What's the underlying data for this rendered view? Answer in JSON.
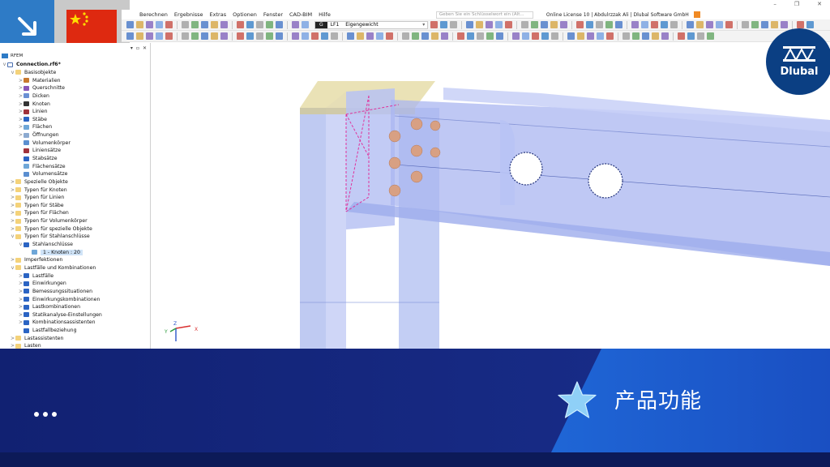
{
  "menu": {
    "items": [
      "Berechnen",
      "Ergebnisse",
      "Extras",
      "Optionen",
      "Fenster",
      "CAD-BIM",
      "Hilfe"
    ],
    "search_placeholder": "Geben Sie ein Schlüsselwort ein (Alt...",
    "license_text": "Online License 10 | Abdulrzzak Ali | Dlubal Software GmbH"
  },
  "toolbar": {
    "loadcase_group": "G",
    "loadcase_id": "LF1",
    "loadcase_name": "Eigengewicht"
  },
  "navigator": {
    "root_label": "RFEM",
    "file_label": "Connection.rf6*",
    "items": [
      {
        "label": "Basisobjekte",
        "level": 1,
        "chev": "v",
        "icon": "folder-icon",
        "color": "#f4d27a"
      },
      {
        "label": "Materialien",
        "level": 2,
        "chev": ">",
        "icon": "material-icon",
        "color": "#c9792e"
      },
      {
        "label": "Querschnitte",
        "level": 2,
        "chev": ">",
        "icon": "section-icon",
        "color": "#8a56b8"
      },
      {
        "label": "Dicken",
        "level": 2,
        "chev": ">",
        "icon": "thickness-icon",
        "color": "#6a8fd3"
      },
      {
        "label": "Knoten",
        "level": 2,
        "chev": ">",
        "icon": "node-icon",
        "color": "#333333"
      },
      {
        "label": "Linien",
        "level": 2,
        "chev": ">",
        "icon": "line-icon",
        "color": "#a0323c"
      },
      {
        "label": "Stäbe",
        "level": 2,
        "chev": ">",
        "icon": "member-icon",
        "color": "#2b64c3"
      },
      {
        "label": "Flächen",
        "level": 2,
        "chev": ">",
        "icon": "surface-icon",
        "color": "#6fa7d8"
      },
      {
        "label": "Öffnungen",
        "level": 2,
        "chev": ">",
        "icon": "opening-icon",
        "color": "#8caad0"
      },
      {
        "label": "Volumenkörper",
        "level": 2,
        "chev": "",
        "icon": "solid-icon",
        "color": "#5b8fd0"
      },
      {
        "label": "Liniensätze",
        "level": 2,
        "chev": "",
        "icon": "lineset-icon",
        "color": "#a0323c"
      },
      {
        "label": "Stabsätze",
        "level": 2,
        "chev": "",
        "icon": "memberset-icon",
        "color": "#2b64c3"
      },
      {
        "label": "Flächensätze",
        "level": 2,
        "chev": "",
        "icon": "surfaceset-icon",
        "color": "#6fa7d8"
      },
      {
        "label": "Volumensätze",
        "level": 2,
        "chev": "",
        "icon": "solidset-icon",
        "color": "#5b8fd0"
      },
      {
        "label": "Spezielle Objekte",
        "level": 1,
        "chev": ">",
        "icon": "folder-icon",
        "color": "#f4d27a"
      },
      {
        "label": "Typen für Knoten",
        "level": 1,
        "chev": ">",
        "icon": "folder-icon",
        "color": "#f4d27a"
      },
      {
        "label": "Typen für Linien",
        "level": 1,
        "chev": ">",
        "icon": "folder-icon",
        "color": "#f4d27a"
      },
      {
        "label": "Typen für Stäbe",
        "level": 1,
        "chev": ">",
        "icon": "folder-icon",
        "color": "#f4d27a"
      },
      {
        "label": "Typen für Flächen",
        "level": 1,
        "chev": ">",
        "icon": "folder-icon",
        "color": "#f4d27a"
      },
      {
        "label": "Typen für Volumenkörper",
        "level": 1,
        "chev": ">",
        "icon": "folder-icon",
        "color": "#f4d27a"
      },
      {
        "label": "Typen für spezielle Objekte",
        "level": 1,
        "chev": ">",
        "icon": "folder-icon",
        "color": "#f4d27a"
      },
      {
        "label": "Typen für Stahlanschlüsse",
        "level": 1,
        "chev": "v",
        "icon": "folder-icon",
        "color": "#f4d27a"
      },
      {
        "label": "Stahlanschlüsse",
        "level": 2,
        "chev": "v",
        "icon": "steel-joint-icon",
        "color": "#2b64c3"
      },
      {
        "label": "1 - Knoten : 20",
        "level": 3,
        "chev": "",
        "icon": "joint-item-icon",
        "color": "#6fa7d8",
        "selected": true
      },
      {
        "label": "Imperfektionen",
        "level": 1,
        "chev": ">",
        "icon": "folder-icon",
        "color": "#f4d27a"
      },
      {
        "label": "Lastfälle und Kombinationen",
        "level": 1,
        "chev": "v",
        "icon": "folder-icon",
        "color": "#f4d27a"
      },
      {
        "label": "Lastfälle",
        "level": 2,
        "chev": ">",
        "icon": "loadcase-icon",
        "color": "#2b64c3"
      },
      {
        "label": "Einwirkungen",
        "level": 2,
        "chev": ">",
        "icon": "action-icon",
        "color": "#2b64c3"
      },
      {
        "label": "Bemessungssituationen",
        "level": 2,
        "chev": ">",
        "icon": "design-situation-icon",
        "color": "#2b64c3"
      },
      {
        "label": "Einwirkungskombinationen",
        "level": 2,
        "chev": ">",
        "icon": "action-combination-icon",
        "color": "#2b64c3"
      },
      {
        "label": "Lastkombinationen",
        "level": 2,
        "chev": ">",
        "icon": "load-combination-icon",
        "color": "#2b64c3"
      },
      {
        "label": "Statikanalyse-Einstellungen",
        "level": 2,
        "chev": ">",
        "icon": "analysis-settings-icon",
        "color": "#2b64c3"
      },
      {
        "label": "Kombinationsassistenten",
        "level": 2,
        "chev": ">",
        "icon": "combination-wizard-icon",
        "color": "#2b64c3"
      },
      {
        "label": "Lastfallbeziehung",
        "level": 2,
        "chev": "",
        "icon": "relationship-icon",
        "color": "#2b64c3"
      },
      {
        "label": "Lastassistenten",
        "level": 1,
        "chev": ">",
        "icon": "folder-icon",
        "color": "#f4d27a"
      },
      {
        "label": "Lasten",
        "level": 1,
        "chev": ">",
        "icon": "folder-icon",
        "color": "#f4d27a"
      }
    ]
  },
  "viewport": {
    "axis_x": "X",
    "axis_y": "Y",
    "axis_z": "Z"
  },
  "logo": {
    "text": "Dlubal"
  },
  "banner": {
    "title": "产品功能"
  },
  "colors": {
    "accent_blue": "#2e7bc6",
    "banner_navy": "#13267a",
    "banner_bright": "#1e6fd9",
    "logo_navy": "#0b3f83"
  }
}
